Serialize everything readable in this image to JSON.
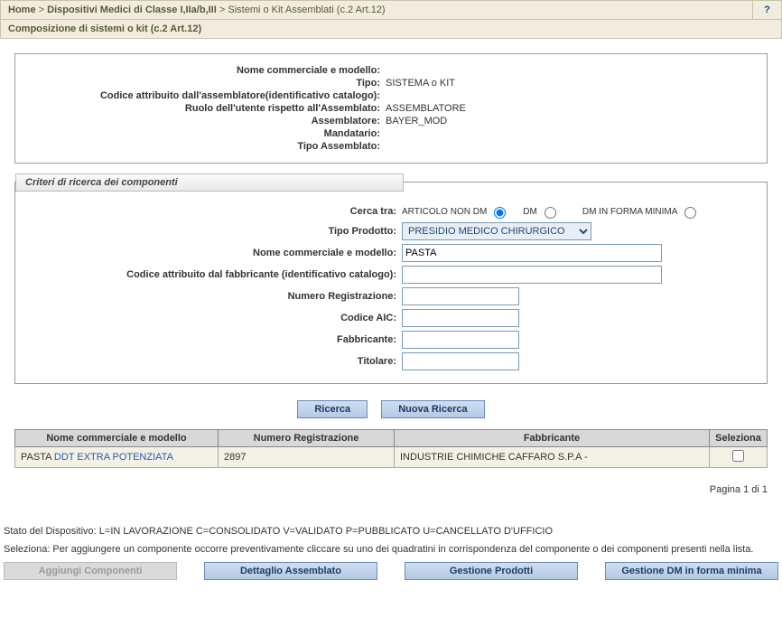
{
  "breadcrumb": {
    "home": "Home",
    "sep": ">",
    "level1": "Dispositivi Medici di Classe I,IIa/b,III",
    "current": "Sistemi o Kit Assemblati (c.2 Art.12)",
    "help": "?"
  },
  "page_title": "Composizione di sistemi o kit (c.2 Art.12)",
  "info": {
    "labels": {
      "nome_commerciale": "Nome commerciale e modello:",
      "tipo": "Tipo:",
      "codice_catalogo": "Codice attribuito dall'assemblatore(identificativo catalogo):",
      "ruolo_utente": "Ruolo dell'utente rispetto all'Assemblato:",
      "assemblatore": "Assemblatore:",
      "mandatario": "Mandatario:",
      "tipo_assemblato": "Tipo Assemblato:"
    },
    "values": {
      "nome_commerciale": "",
      "tipo": "SISTEMA o KIT",
      "codice_catalogo": "",
      "ruolo_utente": "ASSEMBLATORE",
      "assemblatore": "BAYER_MOD",
      "mandatario": "",
      "tipo_assemblato": ""
    }
  },
  "criteri": {
    "legend": "Criteri di ricerca dei componenti",
    "labels": {
      "cerca_tra": "Cerca tra:",
      "tipo_prodotto": "Tipo Prodotto:",
      "nome_commerciale": "Nome commerciale e modello:",
      "codice_fabbricante": "Codice attribuito dal fabbricante (identificativo catalogo):",
      "numero_registrazione": "Numero Registrazione:",
      "codice_aic": "Codice AIC:",
      "fabbricante": "Fabbricante:",
      "titolare": "Titolare:"
    },
    "radios": {
      "articolo_non_dm": "ARTICOLO NON DM",
      "dm": "DM",
      "dm_forma_minima": "DM IN FORMA MINIMA"
    },
    "values": {
      "tipo_prodotto": "PRESIDIO MEDICO CHIRURGICO",
      "nome_commerciale": "PASTA",
      "codice_fabbricante": "",
      "numero_registrazione": "",
      "codice_aic": "",
      "fabbricante": "",
      "titolare": ""
    }
  },
  "buttons": {
    "ricerca": "Ricerca",
    "nuova_ricerca": "Nuova Ricerca",
    "aggiungi_componenti": "Aggiungi Componenti",
    "dettaglio_assemblato": "Dettaglio Assemblato",
    "gestione_prodotti": "Gestione Prodotti",
    "gestione_dm_minima": "Gestione DM in forma minima"
  },
  "table": {
    "headers": {
      "nome": "Nome commerciale e modello",
      "numero": "Numero Registrazione",
      "fabbricante": "Fabbricante",
      "seleziona": "Seleziona"
    },
    "rows": [
      {
        "nome_prefix": "PASTA ",
        "nome_link": "DDT EXTRA POTENZIATA",
        "numero": "2897",
        "fabbricante": "INDUSTRIE CHIMICHE CAFFARO S.P.A -"
      }
    ]
  },
  "pager": "Pagina 1 di 1",
  "status_text": "Stato del Dispositivo: L=IN LAVORAZIONE C=CONSOLIDATO V=VALIDATO P=PUBBLICATO U=CANCELLATO D'UFFICIO",
  "seleziona_hint": "Seleziona: Per aggiungere un componente occorre preventivamente cliccare su uno dei quadratini in corrispondenza del componente o dei componenti presenti nella lista."
}
